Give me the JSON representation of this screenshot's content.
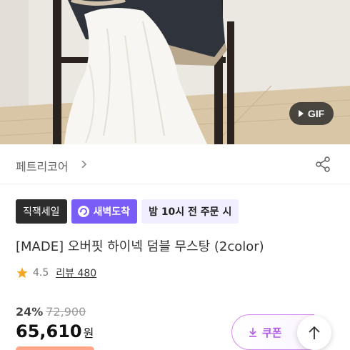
{
  "hero": {
    "gif_label": "GIF"
  },
  "brand": {
    "name": "페트리코어"
  },
  "badges": {
    "direct_sale": "직잭세일",
    "dawn_delivery": "새벽도착",
    "order_deadline": "밤 10시 전 주문 시"
  },
  "product": {
    "title": "[MADE] 오버핏 하이넥 덤블 무스탕 (2color)",
    "rating": "4.5",
    "review_label": "리뷰 480"
  },
  "pricing": {
    "discount_rate": "24%",
    "original_price": "72,900",
    "price": "65,610",
    "currency": "원"
  },
  "actions": {
    "coupon_label": "쿠폰"
  },
  "colors": {
    "accent_purple": "#7a5cf6",
    "coupon_purple": "#b057e8",
    "star": "#f5a623"
  }
}
